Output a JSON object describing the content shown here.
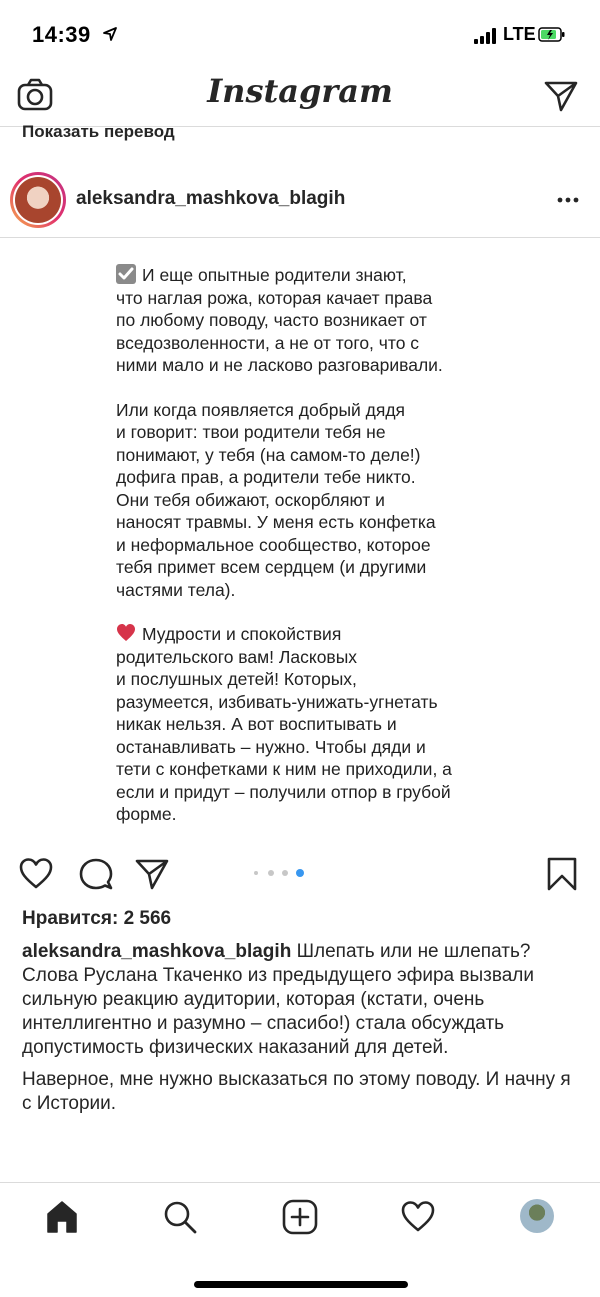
{
  "status_bar": {
    "time": "14:39",
    "network": "LTE"
  },
  "top_nav": {
    "logo": "Instagram"
  },
  "translate_link": "Показать перевод",
  "post": {
    "username": "aleksandra_mashkova_blagih",
    "image_text": {
      "para1": "И еще опытные родители знают,\nчто наглая рожа, которая качает права\nпо любому поводу, часто возникает от\nвседозволенности, а не от того, что с\nними мало и не ласково разговаривали.",
      "para2": "Или когда появляется добрый дядя\nи говорит: твои родители тебя не\nпонимают, у тебя (на самом-то деле!)\nдофига прав, а родители тебе никто.\nОни тебя обижают, оскорбляют и\nнаносят травмы. У меня есть конфетка\nи неформальное сообщество, которое\nтебя примет всем сердцем (и другими\nчастями тела).",
      "para3": "Мудрости и спокойствия\nродительского вам! Ласковых\nи послушных детей! Которых,\nразумеется, избивать-унижать-угнетать\nникак нельзя. А вот воспитывать и\nостанавливать – нужно. Чтобы дяди и\nтети с конфетками к ним не приходили, а\nесли и придут – получили отпор в грубой\nформе."
    },
    "carousel": {
      "total": 4,
      "active_index": 3
    },
    "likes": "Нравится: 2 566",
    "caption": {
      "username": "aleksandra_mashkova_blagih",
      "title": " Шлепать или не шлепать?",
      "body1": "Слова Руслана Ткаченко из предыдущего эфира вызвали сильную реакцию аудитории, которая (кстати, очень интеллигентно и разумно – спасибо!) стала обсуждать допустимость физических наказаний для детей.",
      "body2": "Наверное, мне нужно высказаться по этому поводу. И начну я с Истории."
    }
  },
  "colors": {
    "accent": "#3897f0",
    "text": "#262626",
    "divider": "#dbdbdb",
    "heart_emoji": "#d6344a",
    "battery": "#4cd964"
  }
}
